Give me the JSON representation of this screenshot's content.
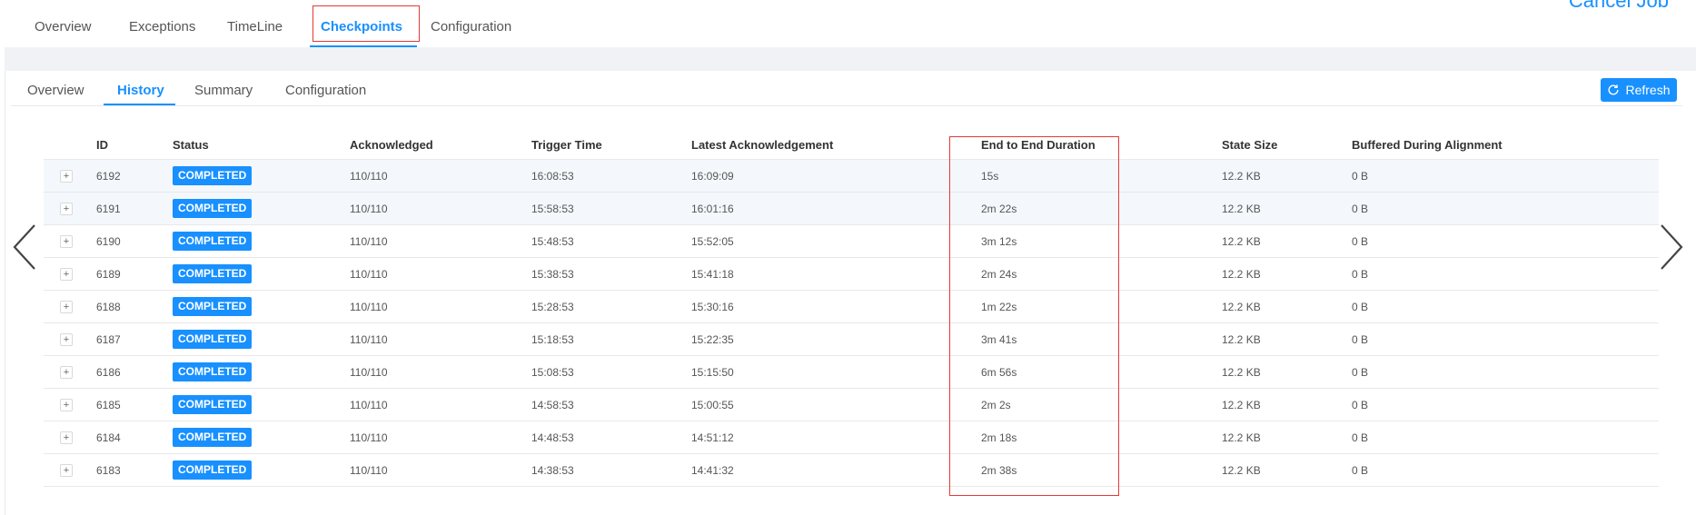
{
  "top_tabs": [
    "Overview",
    "Exceptions",
    "TimeLine",
    "Checkpoints",
    "Configuration"
  ],
  "cancel_job": "Cancel Job",
  "inner_tabs": [
    "Overview",
    "History",
    "Summary",
    "Configuration"
  ],
  "refresh_label": "Refresh",
  "columns": [
    "ID",
    "Status",
    "Acknowledged",
    "Trigger Time",
    "Latest Acknowledgement",
    "End to End Duration",
    "State Size",
    "Buffered During Alignment"
  ],
  "rows": [
    {
      "id": "6192",
      "status": "COMPLETED",
      "ack": "110/110",
      "trigger": "16:08:53",
      "latest": "16:09:09",
      "duration": "15s",
      "state": "12.2 KB",
      "buffered": "0 B"
    },
    {
      "id": "6191",
      "status": "COMPLETED",
      "ack": "110/110",
      "trigger": "15:58:53",
      "latest": "16:01:16",
      "duration": "2m 22s",
      "state": "12.2 KB",
      "buffered": "0 B"
    },
    {
      "id": "6190",
      "status": "COMPLETED",
      "ack": "110/110",
      "trigger": "15:48:53",
      "latest": "15:52:05",
      "duration": "3m 12s",
      "state": "12.2 KB",
      "buffered": "0 B"
    },
    {
      "id": "6189",
      "status": "COMPLETED",
      "ack": "110/110",
      "trigger": "15:38:53",
      "latest": "15:41:18",
      "duration": "2m 24s",
      "state": "12.2 KB",
      "buffered": "0 B"
    },
    {
      "id": "6188",
      "status": "COMPLETED",
      "ack": "110/110",
      "trigger": "15:28:53",
      "latest": "15:30:16",
      "duration": "1m 22s",
      "state": "12.2 KB",
      "buffered": "0 B"
    },
    {
      "id": "6187",
      "status": "COMPLETED",
      "ack": "110/110",
      "trigger": "15:18:53",
      "latest": "15:22:35",
      "duration": "3m 41s",
      "state": "12.2 KB",
      "buffered": "0 B"
    },
    {
      "id": "6186",
      "status": "COMPLETED",
      "ack": "110/110",
      "trigger": "15:08:53",
      "latest": "15:15:50",
      "duration": "6m 56s",
      "state": "12.2 KB",
      "buffered": "0 B"
    },
    {
      "id": "6185",
      "status": "COMPLETED",
      "ack": "110/110",
      "trigger": "14:58:53",
      "latest": "15:00:55",
      "duration": "2m 2s",
      "state": "12.2 KB",
      "buffered": "0 B"
    },
    {
      "id": "6184",
      "status": "COMPLETED",
      "ack": "110/110",
      "trigger": "14:48:53",
      "latest": "14:51:12",
      "duration": "2m 18s",
      "state": "12.2 KB",
      "buffered": "0 B"
    },
    {
      "id": "6183",
      "status": "COMPLETED",
      "ack": "110/110",
      "trigger": "14:38:53",
      "latest": "14:41:32",
      "duration": "2m 38s",
      "state": "12.2 KB",
      "buffered": "0 B"
    }
  ],
  "expand_glyph": "+",
  "colors": {
    "accent": "#1890ff",
    "highlight_box": "#e53935",
    "band": "#f0f2f5"
  },
  "icons": {
    "refresh": "refresh-icon",
    "prev": "chevron-left-icon",
    "next": "chevron-right-icon"
  }
}
